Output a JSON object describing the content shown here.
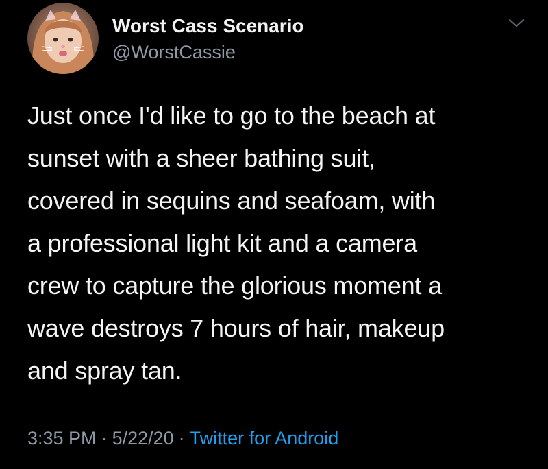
{
  "tweet": {
    "author": {
      "display_name": "Worst Cass Scenario",
      "handle": "@WorstCassie"
    },
    "menu_icon": "chevron-down-icon",
    "text_lines": [
      "Just once I'd like to go to the beach at",
      "sunset with a sheer bathing suit,",
      "covered in sequins and seafoam, with",
      "a professional light kit and a camera",
      "crew to capture the glorious moment a",
      "wave destroys 7 hours of hair, makeup",
      "and spray tan."
    ],
    "meta": {
      "time": "3:35 PM",
      "separator": "·",
      "date": "5/22/20",
      "source": "Twitter for Android"
    }
  },
  "colors": {
    "background": "#000000",
    "text": "#f4f4f4",
    "secondary_text": "#8d9aa6",
    "link": "#1da1f2"
  }
}
